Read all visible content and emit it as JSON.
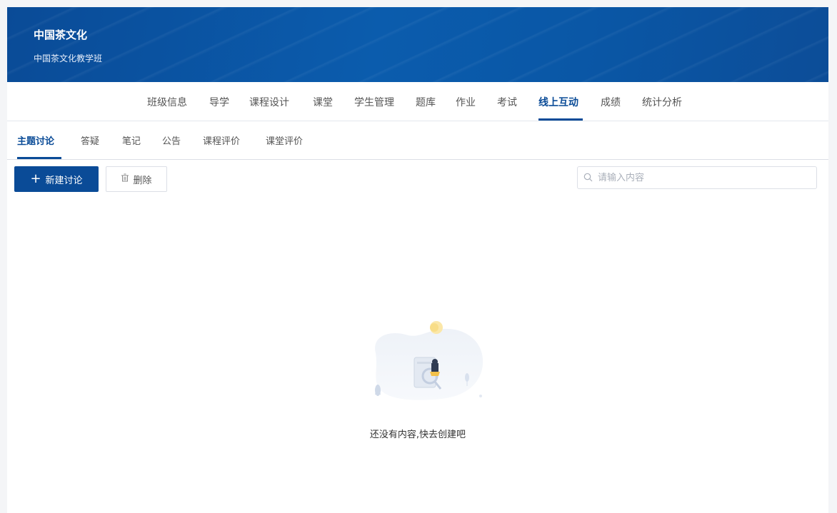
{
  "header": {
    "course_title": "中国茶文化",
    "class_name": "中国茶文化教学班"
  },
  "main_nav": {
    "items": [
      "班级信息",
      "导学",
      "课程设计",
      "课堂",
      "学生管理",
      "题库",
      "作业",
      "考试",
      "线上互动",
      "成绩",
      "统计分析"
    ],
    "active": "线上互动"
  },
  "sub_nav": {
    "items": [
      "主题讨论",
      "答疑",
      "笔记",
      "公告",
      "课程评价",
      "课堂评价"
    ],
    "active": "主题讨论"
  },
  "toolbar": {
    "new_label": "新建讨论",
    "delete_label": "删除",
    "search_placeholder": "请输入内容"
  },
  "empty_state": {
    "message": "还没有内容,快去创建吧"
  },
  "colors": {
    "primary": "#0a4b97",
    "banner": "#0b5cad"
  }
}
